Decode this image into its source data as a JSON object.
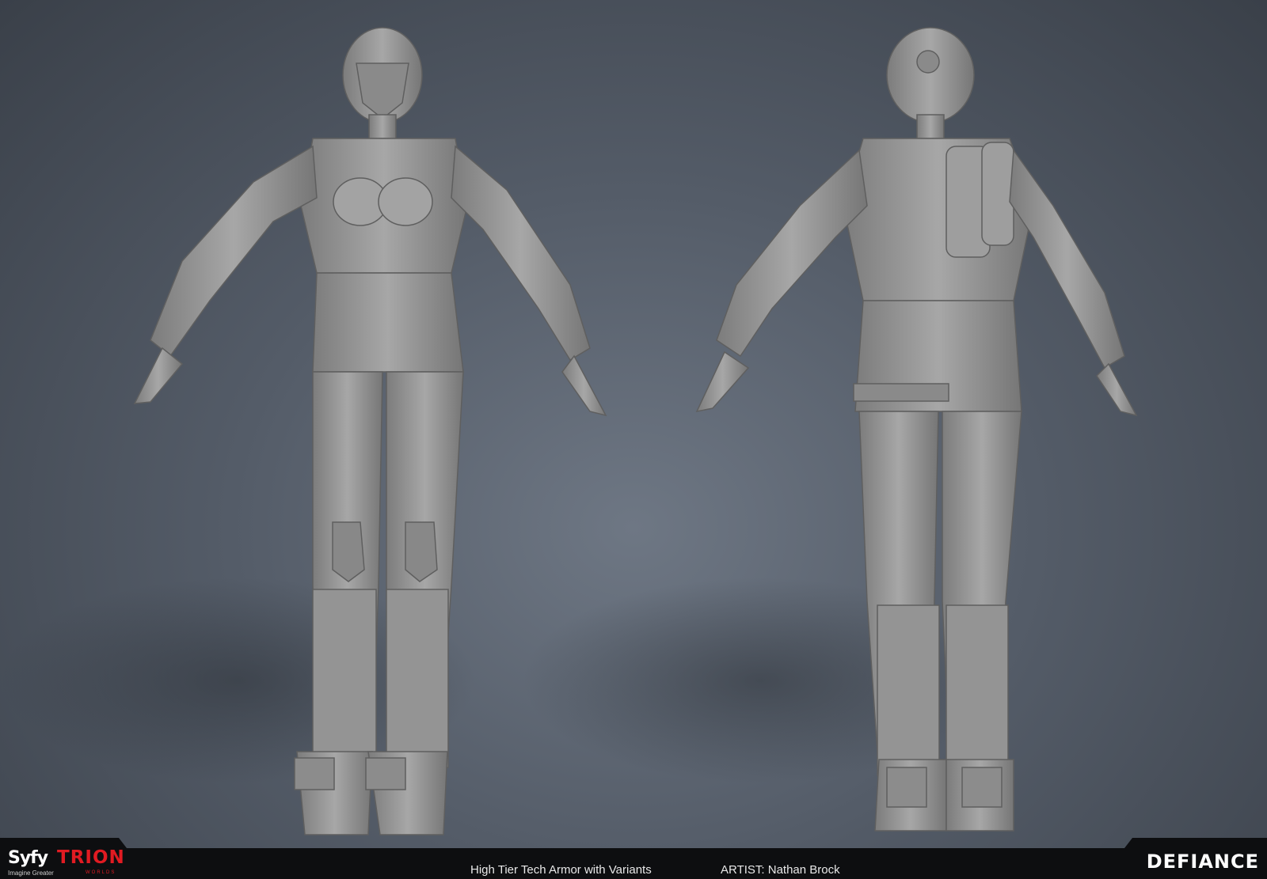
{
  "footer": {
    "syfy_logo": "Syfy",
    "syfy_tagline": "Imagine Greater",
    "trion_logo": "TRION",
    "trion_sub": "WORLDS",
    "defiance_logo": "DEFIANCE",
    "title": "High Tier Tech Armor with Variants",
    "artist": "ARTIST: Nathan Brock"
  },
  "colors": {
    "background": "#545c68",
    "model_gray": "#9a9a9a",
    "bar": "#0d0e10",
    "trion_red": "#e11b22"
  }
}
